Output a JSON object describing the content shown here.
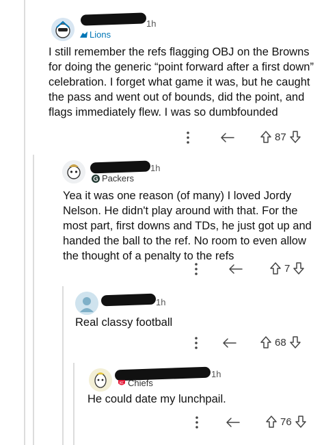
{
  "comments": [
    {
      "time": "1h",
      "flair": "Lions",
      "flair_color": "#0076b6",
      "body": "I still remember the refs flagging OBJ on the Browns for doing the generic “point forward after a first down” celebration. I forget what game it was, but he caught the pass and went out of bounds, did the point, and flags immediately flew. I was so dumbfounded",
      "votes": "87",
      "icons": [
        "more-options-icon",
        "reply-icon",
        "upvote-icon",
        "downvote-icon"
      ]
    },
    {
      "time": "1h",
      "flair": "Packers",
      "flair_color": "#203731",
      "body": "Yea it was one reason (of many) I loved Jordy Nelson. He didn't play around with that. For the most part, first downs and TDs, he just got up and handed the ball to the ref. No room to even allow the thought of a penalty to the refs",
      "votes": "7"
    },
    {
      "time": "1h",
      "flair": "",
      "body": "Real classy football",
      "votes": "68"
    },
    {
      "time": "1h",
      "flair": "Chiefs",
      "flair_color": "#e31837",
      "body": "He could date my lunchpail.",
      "votes": "76"
    }
  ]
}
